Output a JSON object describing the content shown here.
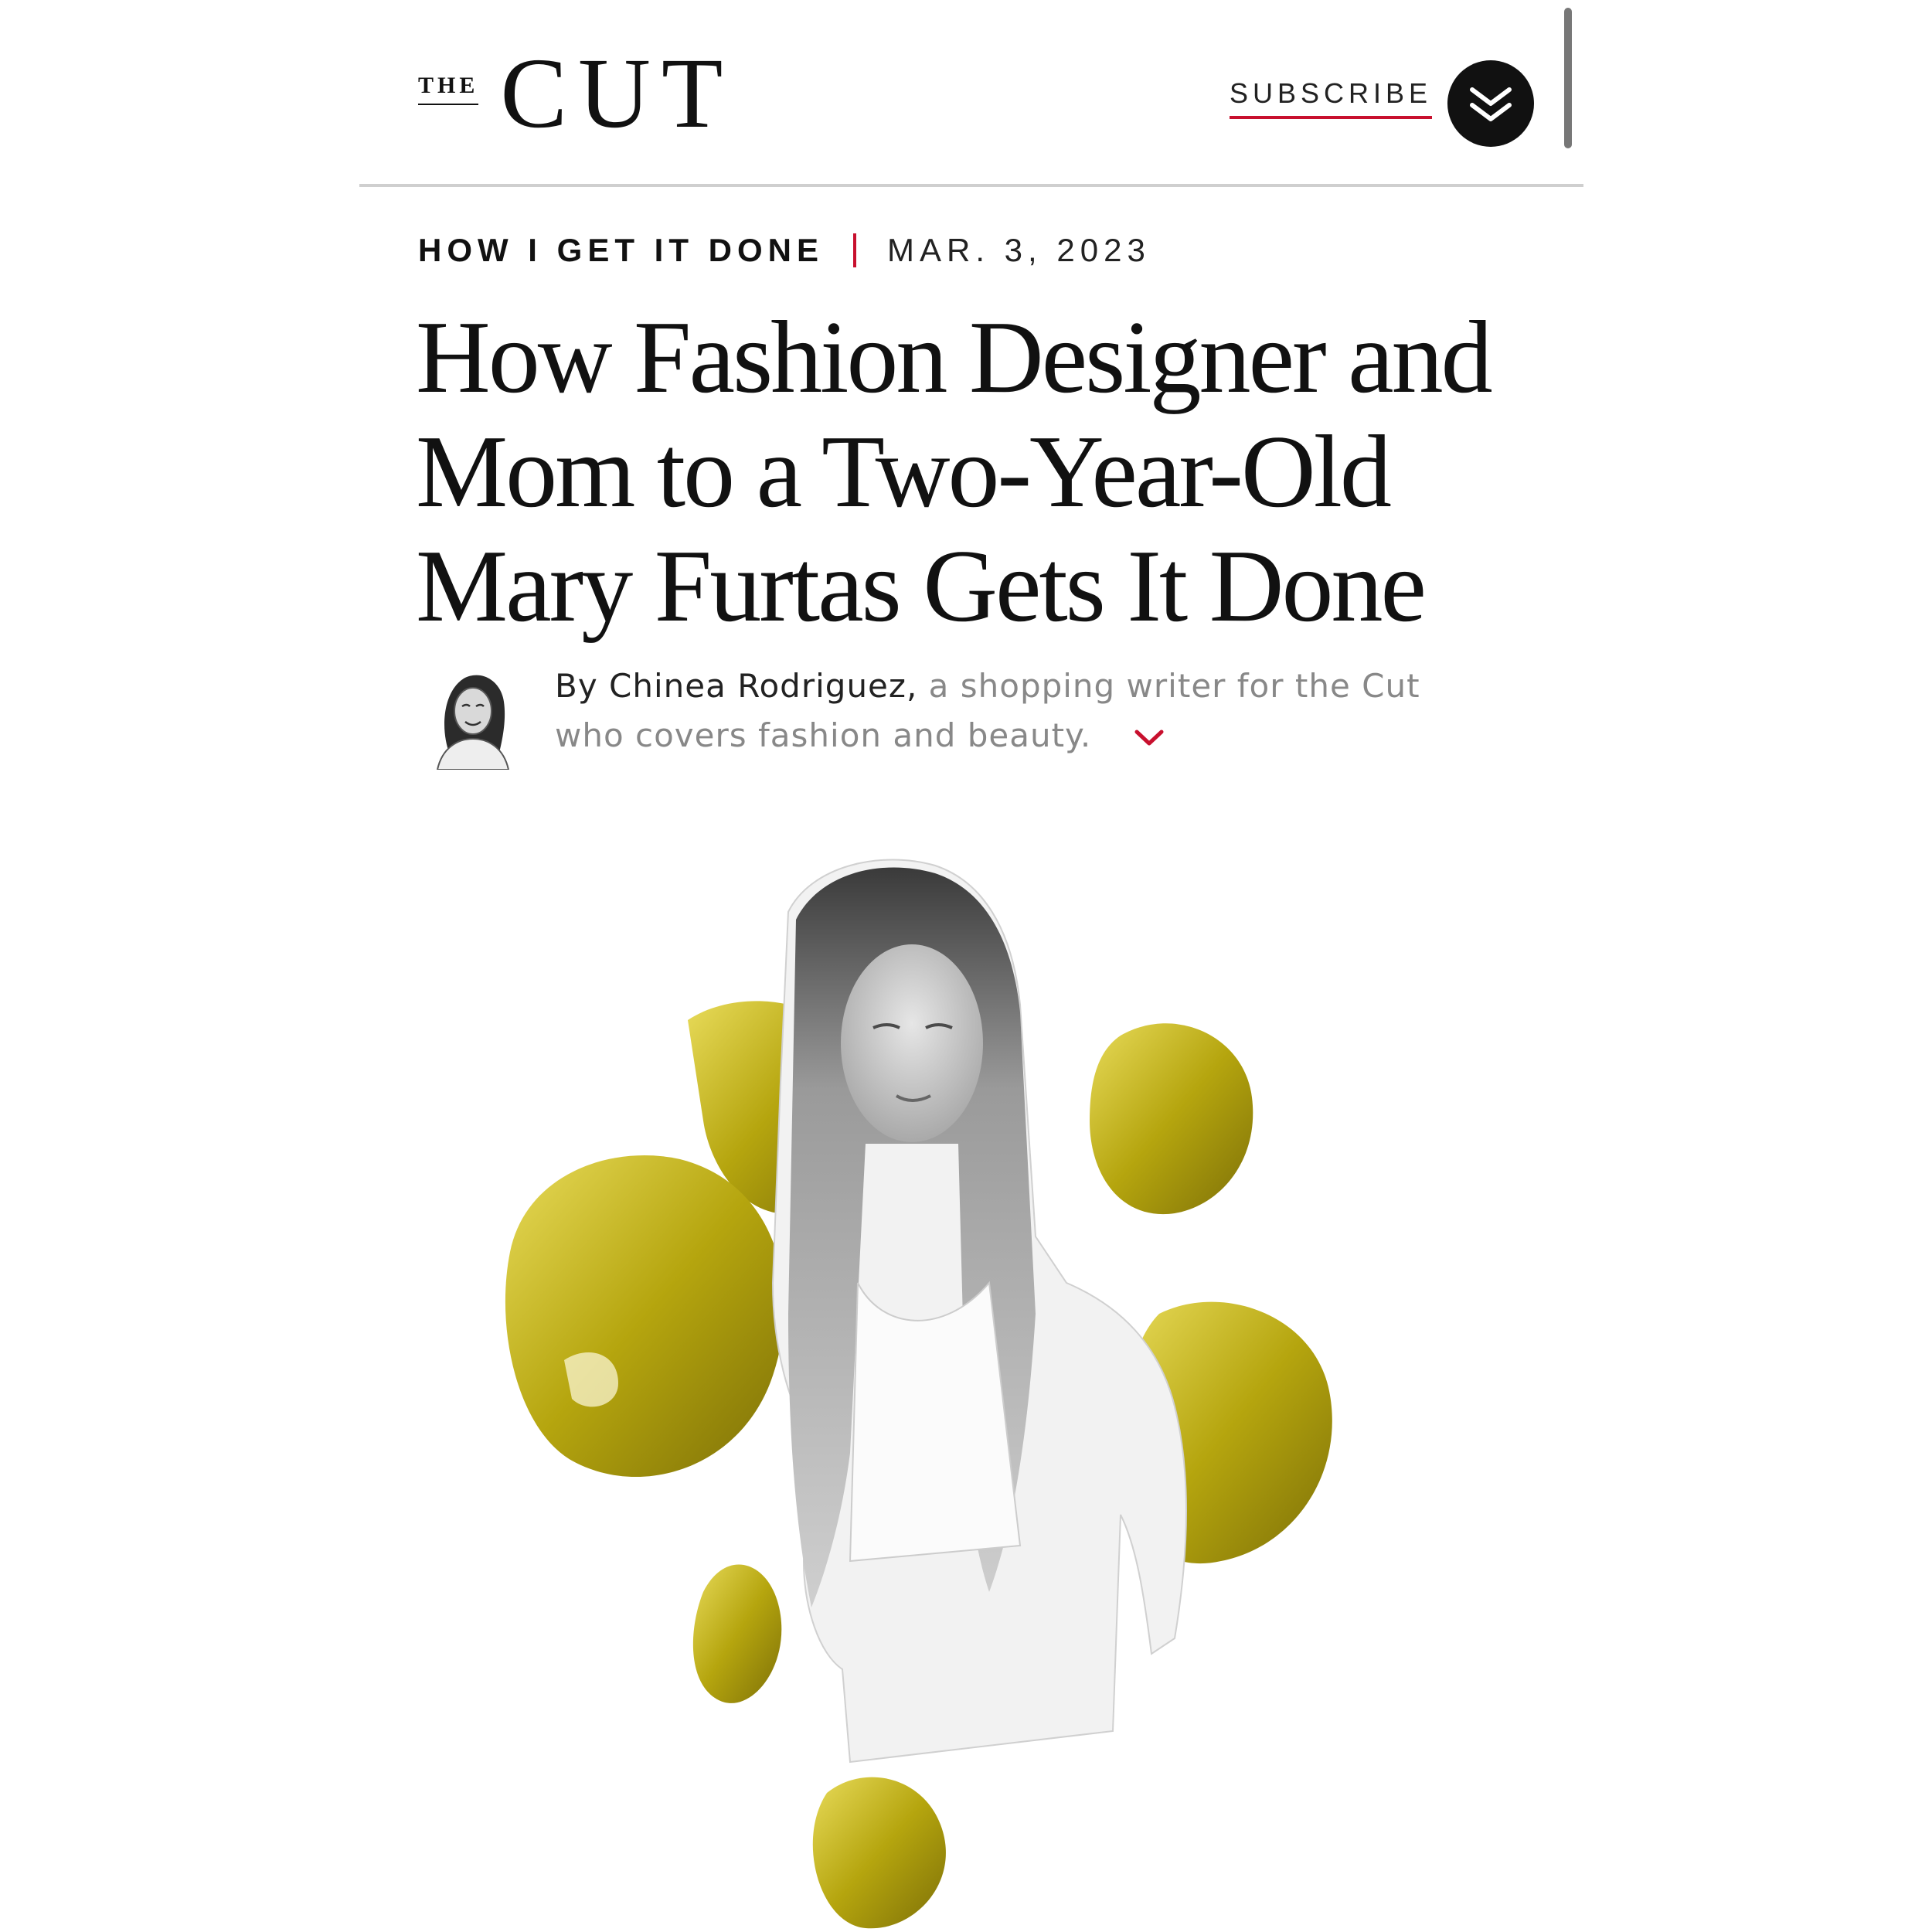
{
  "header": {
    "logo_the": "THE",
    "logo_cut": "CUT",
    "subscribe_label": "SUBSCRIBE",
    "menu_icon": "double-chevron-down-icon"
  },
  "article": {
    "rubric": "HOW I GET IT DONE",
    "date": "MAR. 3, 2023",
    "headline_lines": [
      "How Fashion Designer and",
      "Mom to a Two-Year-Old",
      "Mary Furtas Gets It Done"
    ],
    "byline": {
      "prefix": "By",
      "author": "Chinea Rodriguez,",
      "bio_line1": "a shopping writer for the Cut",
      "bio_line2": "who covers fashion and beauty.",
      "expand_icon": "chevron-down-icon"
    }
  },
  "colors": {
    "accent_red": "#c8102e",
    "text": "#111111",
    "muted_text": "#888888",
    "divider": "#cfcfcf",
    "hero_yellow": "#b5a50e"
  }
}
